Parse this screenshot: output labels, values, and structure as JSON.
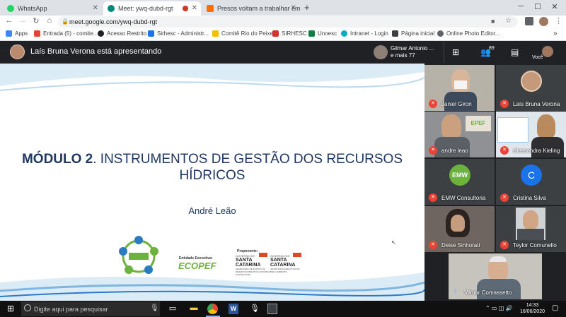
{
  "browser": {
    "tabs": [
      {
        "title": "WhatsApp",
        "color": "#25d366"
      },
      {
        "title": "Meet: ywq-dubd-rgt",
        "color": "#00897b"
      },
      {
        "title": "Presos voltam a trabalhar em Sa...",
        "color": "#ff6d00"
      }
    ],
    "url": "meet.google.com/ywq-dubd-rgt",
    "bookmarks": [
      {
        "label": "Apps",
        "color": "#4285f4"
      },
      {
        "label": "Entrada (5) - comite...",
        "color": "#ea4335"
      },
      {
        "label": "Acesso Restrito",
        "color": "#202124"
      },
      {
        "label": "Sirhesc - Administr...",
        "color": "#1a73e8"
      },
      {
        "label": "Comitê Rio do Peixe",
        "color": "#fbbc04"
      },
      {
        "label": "SIRHESC",
        "color": "#d93025"
      },
      {
        "label": "Unoesc",
        "color": "#0b8043"
      },
      {
        "label": "Intranet - Login",
        "color": "#00acc1"
      },
      {
        "label": "Página inicial",
        "color": "#3c4043"
      },
      {
        "label": "Online Photo Editor...",
        "color": "#5f6368"
      }
    ]
  },
  "meet": {
    "presenter_text": "Laís Bruna Verona está apresentando",
    "pinned_name_line1": "Gilmar Antonio ...",
    "pinned_name_line2": "e mais 77",
    "participant_count": "89",
    "self_label": "Você",
    "participants": [
      {
        "name": "Janiel Giron",
        "muted": true
      },
      {
        "name": "Laís Bruna Verona",
        "muted": true
      },
      {
        "name": "andre leao",
        "muted": true
      },
      {
        "name": "Alessandra Kieling",
        "muted": true
      },
      {
        "name": "EMW Consultoria",
        "muted": true,
        "logo_text": "EMW"
      },
      {
        "name": "Cristina Silva",
        "muted": true,
        "initial": "C"
      },
      {
        "name": "Deise Sinhorati",
        "muted": true
      },
      {
        "name": "Teylor Comunello",
        "muted": true
      },
      {
        "name": "Vilmar Comassetto",
        "muted": false
      }
    ]
  },
  "slide": {
    "title_bold": "MÓDULO 2",
    "title_rest": ". INSTRUMENTOS DE GESTÃO DOS RECURSOS HÍDRICOS",
    "author": "André Leão",
    "entidade_label": "Entidade Executiva:",
    "proponente_label": "Proponente:",
    "ecopef": "ECOPEF",
    "governo1_top": "GOVERNO DE",
    "governo1_state": "SANTA CATARINA",
    "governo1_sub": "SECRETARIA DE ESTADO DO DESENVOLVIMENTO ECONÔMICO SUSTENTÁVEL",
    "governo2_top": "GOVERNO DE",
    "governo2_state": "SANTA CATARINA",
    "governo2_sub": "SECRETARIA EXECUTIVA DO MEIO AMBIENTE"
  },
  "taskbar": {
    "search_placeholder": "Digite aqui para pesquisar",
    "time": "14:33",
    "date": "16/06/2020"
  }
}
